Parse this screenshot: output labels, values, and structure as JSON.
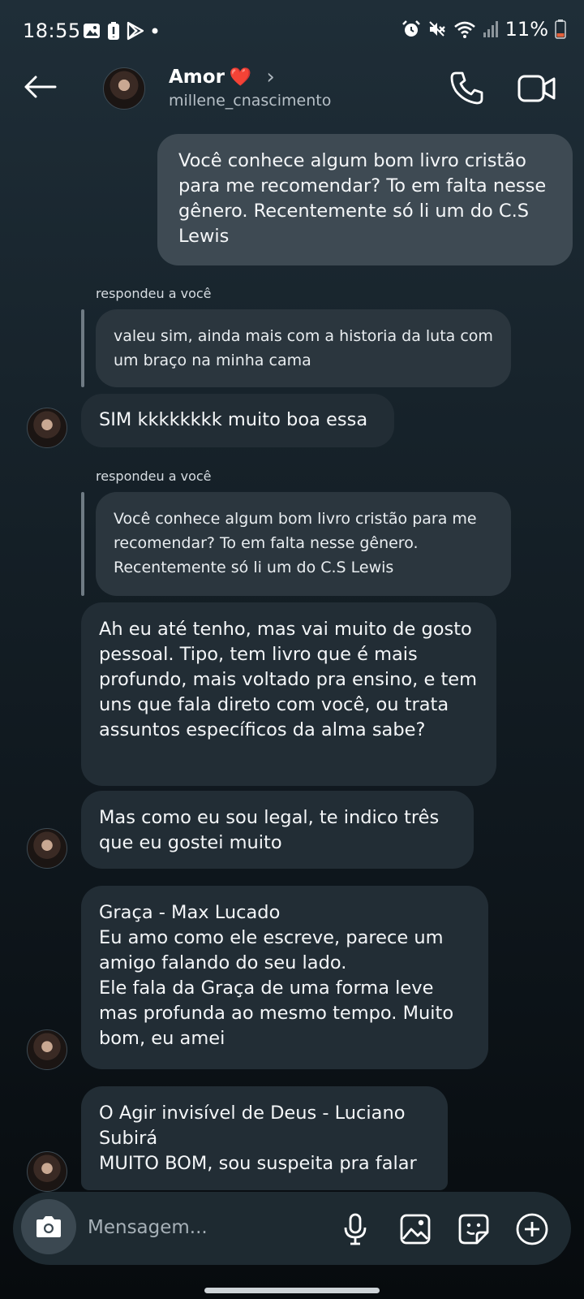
{
  "status_bar": {
    "time": "18:55",
    "battery": "11%",
    "left_icons": [
      "gallery-icon",
      "battery-saver-icon",
      "play-store-icon",
      "dot-icon"
    ],
    "right_icons": [
      "alarm-icon",
      "mute-icon",
      "wifi-icon",
      "signal-icon",
      "battery-icon"
    ]
  },
  "header": {
    "contact_name": "Amor",
    "heart": "❤️",
    "chevron": "›",
    "username": "millene_cnascimento"
  },
  "messages": {
    "m1": "Você conhece algum bom livro cristão para me recomendar? To em falta nesse gênero. Recentemente só li um do C.S Lewis",
    "reply1_label": "respondeu a você",
    "quote1": "valeu sim, ainda mais com a historia da luta com um braço na minha cama",
    "m2": "SIM kkkkkkkk muito boa essa",
    "reply2_label": "respondeu a você",
    "quote2": "Você conhece algum bom livro cristão para me recomendar? To em falta nesse gênero. Recentemente só li um do C.S Lewis",
    "m3": "Ah eu até tenho, mas vai muito de gosto pessoal. Tipo, tem livro que é mais profundo, mais voltado pra ensino, e tem uns que fala direto com você, ou trata assuntos específicos da alma sabe?",
    "m4": "Mas como eu sou legal, te indico três que eu gostei muito",
    "m5": "Graça - Max Lucado\nEu amo como ele escreve, parece um amigo falando do seu lado.\nEle fala da Graça de uma forma leve mas profunda ao mesmo tempo. Muito bom, eu amei",
    "m6": "O Agir invisível de Deus - Luciano Subirá\nMUITO BOM, sou suspeita pra falar"
  },
  "composer": {
    "placeholder": "Mensagem..."
  },
  "colors": {
    "sent_bubble": "#3e4a53",
    "received_bubble": "#222d35",
    "quote_bubble": "#2b363e",
    "heart": "#e5252f"
  }
}
